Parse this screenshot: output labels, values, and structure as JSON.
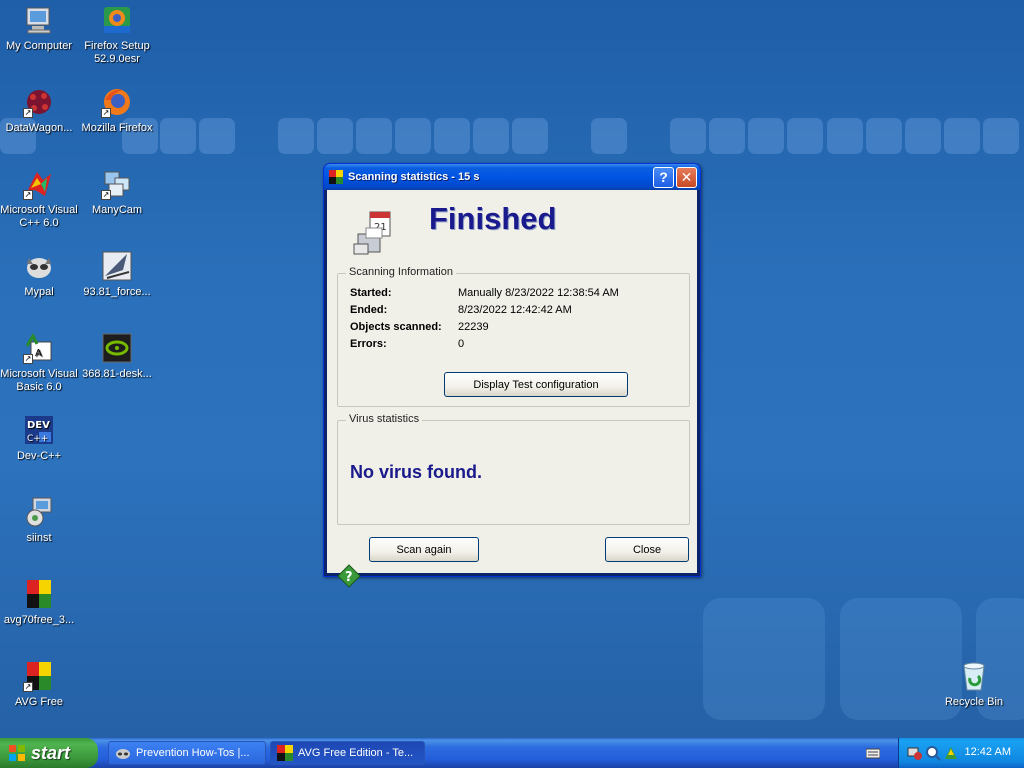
{
  "desktop": {
    "icons": [
      {
        "label": "My Computer",
        "icon": "my-computer-icon"
      },
      {
        "label": "Firefox Setup 52.9.0esr",
        "icon": "firefox-setup-icon"
      },
      {
        "label": "DataWagon...",
        "icon": "datawagon-icon"
      },
      {
        "label": "Mozilla Firefox",
        "icon": "firefox-icon"
      },
      {
        "label": "Microsoft Visual C++ 6.0",
        "icon": "visual-cpp-icon"
      },
      {
        "label": "ManyCam",
        "icon": "manycam-icon"
      },
      {
        "label": "Mypal",
        "icon": "mypal-icon"
      },
      {
        "label": "93.81_force...",
        "icon": "installer-icon"
      },
      {
        "label": "Microsoft Visual Basic 6.0",
        "icon": "visual-basic-icon"
      },
      {
        "label": "368.81-desk...",
        "icon": "nvidia-icon"
      },
      {
        "label": "Dev-C++",
        "icon": "devcpp-icon"
      },
      {
        "label": "siinst",
        "icon": "setup-icon"
      },
      {
        "label": "avg70free_3...",
        "icon": "avg-installer-icon"
      },
      {
        "label": "AVG Free",
        "icon": "avg-icon"
      },
      {
        "label": "Recycle Bin",
        "icon": "recycle-bin-icon"
      }
    ]
  },
  "dialog": {
    "title": "Scanning statistics - 15 s",
    "heading": "Finished",
    "scanning_info": {
      "group_label": "Scanning Information",
      "rows": [
        {
          "key": "Started:",
          "value": "Manually 8/23/2022 12:38:54 AM"
        },
        {
          "key": "Ended:",
          "value": "8/23/2022 12:42:42 AM"
        },
        {
          "key": "Objects scanned:",
          "value": "22239"
        },
        {
          "key": "Errors:",
          "value": "0"
        }
      ],
      "button": "Display Test configuration"
    },
    "virus_stats": {
      "group_label": "Virus statistics",
      "result": "No virus found."
    },
    "scan_again": "Scan again",
    "close": "Close"
  },
  "taskbar": {
    "start": "start",
    "tasks": [
      {
        "label": "Prevention How-Tos |...",
        "state": "inactive"
      },
      {
        "label": "AVG Free Edition - Te...",
        "state": "active"
      }
    ],
    "clock": "12:42 AM"
  },
  "colors": {
    "desktop": "#2a6fb9",
    "titlebar": "#0054e3",
    "heading": "#1a1a8c",
    "start_button": "#3a963a"
  }
}
